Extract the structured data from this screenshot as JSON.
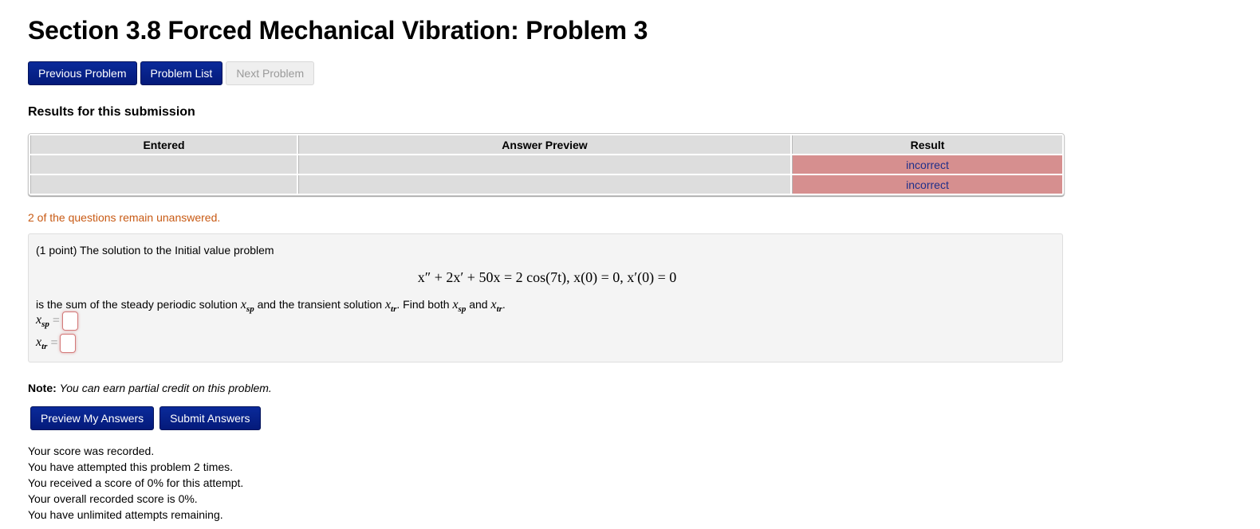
{
  "header": {
    "title": "Section 3.8 Forced Mechanical Vibration: Problem 3"
  },
  "nav": {
    "previous": "Previous Problem",
    "list": "Problem List",
    "next": "Next Problem"
  },
  "results": {
    "title": "Results for this submission",
    "columns": [
      "Entered",
      "Answer Preview",
      "Result"
    ],
    "rows": [
      {
        "entered": "",
        "preview": "",
        "result": "incorrect"
      },
      {
        "entered": "",
        "preview": "",
        "result": "incorrect"
      }
    ],
    "incorrect_color": "#d68f8f",
    "unanswered_message": "2 of the questions remain unanswered."
  },
  "problem": {
    "intro": "(1 point) The solution to the Initial value problem",
    "equation": "x″ + 2x′ + 50x = 2 cos(7t),    x(0) = 0, x′(0) = 0",
    "desc_part1": "is the sum of the steady periodic solution ",
    "desc_part2": " and the transient solution ",
    "desc_part3": ". Find both ",
    "desc_part4": " and ",
    "desc_part5": ".",
    "var_x": "x",
    "sub_sp": "sp",
    "sub_tr": "tr",
    "equals": "=",
    "answers": [
      {
        "label_sub": "sp",
        "value": ""
      },
      {
        "label_sub": "tr",
        "value": ""
      }
    ]
  },
  "note": {
    "label": "Note:",
    "text": "You can earn partial credit on this problem."
  },
  "actions": {
    "preview": "Preview My Answers",
    "submit": "Submit Answers"
  },
  "status": {
    "lines": [
      "Your score was recorded.",
      "You have attempted this problem 2 times.",
      "You received a score of 0% for this attempt.",
      "Your overall recorded score is 0%.",
      "You have unlimited attempts remaining."
    ]
  }
}
